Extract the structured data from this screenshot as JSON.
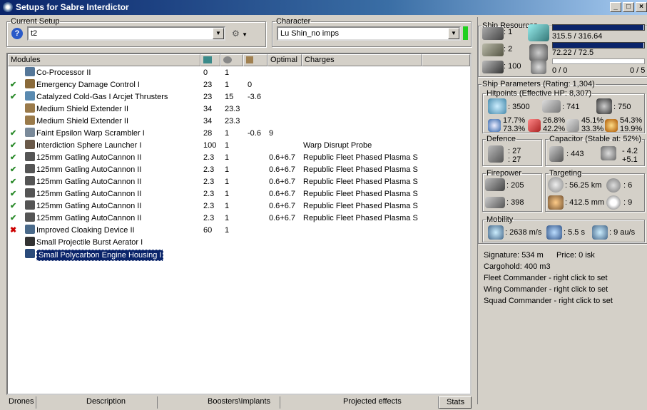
{
  "window": {
    "title": "Setups for Sabre Interdictor",
    "buttons": [
      "_",
      "□",
      "×"
    ]
  },
  "current_setup": {
    "legend": "Current Setup",
    "value": "t2"
  },
  "character": {
    "legend": "Character",
    "value": "Lu Shin_no imps"
  },
  "modules": {
    "headers": [
      "Modules",
      "",
      "",
      "",
      "Optimal",
      "Charges"
    ],
    "rows": [
      {
        "status": "",
        "name": "Co-Processor II",
        "c1": "0",
        "c2": "1",
        "c3": "",
        "optimal": "",
        "charges": "",
        "icon": "cpu-icon",
        "color": "#557799"
      },
      {
        "status": "check",
        "name": "Emergency Damage Control I",
        "c1": "23",
        "c2": "1",
        "c3": "0",
        "optimal": "",
        "charges": "",
        "icon": "damage-control-icon",
        "color": "#8a6a3a"
      },
      {
        "status": "check",
        "name": "Catalyzed Cold-Gas I Arcjet Thrusters",
        "c1": "23",
        "c2": "15",
        "c3": "-3.6",
        "optimal": "",
        "charges": "",
        "icon": "thruster-icon",
        "color": "#5a8ab0"
      },
      {
        "status": "",
        "name": "Medium Shield Extender II",
        "c1": "34",
        "c2": "23.3",
        "c3": "",
        "optimal": "",
        "charges": "",
        "icon": "shield-extender-icon",
        "color": "#9a7a4a"
      },
      {
        "status": "",
        "name": "Medium Shield Extender II",
        "c1": "34",
        "c2": "23.3",
        "c3": "",
        "optimal": "",
        "charges": "",
        "icon": "shield-extender-icon",
        "color": "#9a7a4a"
      },
      {
        "status": "check",
        "name": "Faint Epsilon Warp Scrambler I",
        "c1": "28",
        "c2": "1",
        "c3": "-0.6",
        "optimal": "9",
        "charges": "",
        "icon": "warp-scrambler-icon",
        "color": "#7a8a9a"
      },
      {
        "status": "check",
        "name": "Interdiction Sphere Launcher I",
        "c1": "100",
        "c2": "1",
        "c3": "",
        "optimal": "",
        "charges": "Warp Disrupt Probe",
        "icon": "launcher-icon",
        "color": "#6a5a4a"
      },
      {
        "status": "check",
        "name": "125mm Gatling AutoCannon II",
        "c1": "2.3",
        "c2": "1",
        "c3": "",
        "optimal": "0.6+6.7",
        "charges": "Republic Fleet Phased Plasma S",
        "icon": "autocannon-icon",
        "color": "#555555"
      },
      {
        "status": "check",
        "name": "125mm Gatling AutoCannon II",
        "c1": "2.3",
        "c2": "1",
        "c3": "",
        "optimal": "0.6+6.7",
        "charges": "Republic Fleet Phased Plasma S",
        "icon": "autocannon-icon",
        "color": "#555555"
      },
      {
        "status": "check",
        "name": "125mm Gatling AutoCannon II",
        "c1": "2.3",
        "c2": "1",
        "c3": "",
        "optimal": "0.6+6.7",
        "charges": "Republic Fleet Phased Plasma S",
        "icon": "autocannon-icon",
        "color": "#555555"
      },
      {
        "status": "check",
        "name": "125mm Gatling AutoCannon II",
        "c1": "2.3",
        "c2": "1",
        "c3": "",
        "optimal": "0.6+6.7",
        "charges": "Republic Fleet Phased Plasma S",
        "icon": "autocannon-icon",
        "color": "#555555"
      },
      {
        "status": "check",
        "name": "125mm Gatling AutoCannon II",
        "c1": "2.3",
        "c2": "1",
        "c3": "",
        "optimal": "0.6+6.7",
        "charges": "Republic Fleet Phased Plasma S",
        "icon": "autocannon-icon",
        "color": "#555555"
      },
      {
        "status": "check",
        "name": "125mm Gatling AutoCannon II",
        "c1": "2.3",
        "c2": "1",
        "c3": "",
        "optimal": "0.6+6.7",
        "charges": "Republic Fleet Phased Plasma S",
        "icon": "autocannon-icon",
        "color": "#555555"
      },
      {
        "status": "x",
        "name": "Improved Cloaking Device II",
        "c1": "60",
        "c2": "1",
        "c3": "",
        "optimal": "",
        "charges": "",
        "icon": "cloak-icon",
        "color": "#4a6a8a"
      },
      {
        "status": "",
        "name": "Small Projectile Burst Aerator I",
        "c1": "",
        "c2": "",
        "c3": "",
        "optimal": "",
        "charges": "",
        "icon": "rig-icon",
        "color": "#333333"
      },
      {
        "status": "",
        "name": "Small Polycarbon Engine Housing I",
        "c1": "",
        "c2": "",
        "c3": "",
        "optimal": "",
        "charges": "",
        "icon": "rig-icon",
        "color": "#2a4a7a",
        "selected": true
      }
    ]
  },
  "tabs": [
    "Drones",
    "Description",
    "Boosters\\Implants",
    "Projected effects",
    "Stats"
  ],
  "resources": {
    "legend": "Ship Resources",
    "hardpoints": [
      ": 1",
      ": 2",
      ": 100"
    ],
    "cpu": {
      "text": "315.5 / 316.64",
      "fraction": 0.996
    },
    "power": {
      "text": "72.22 / 72.5",
      "fraction": 0.996
    },
    "calibration": {
      "left": "0 / 0",
      "right": "0 / 5"
    }
  },
  "params": {
    "legend": "Ship Parameters (Rating: 1,304)",
    "hitpoints": {
      "legend": "Hitpoints (Effective HP: 8,307)",
      "shield": ": 3500",
      "armor": ": 741",
      "structure": ": 750",
      "em": [
        "17.7%",
        "73.3%"
      ],
      "thermal": [
        "26.8%",
        "42.2%"
      ],
      "kinetic": [
        "45.1%",
        "33.3%"
      ],
      "explosive": [
        "54.3%",
        "19.9%"
      ]
    },
    "defence": {
      "legend": "Defence",
      "v1": ": 27",
      "v2": ": 27"
    },
    "capacitor": {
      "legend": "Capacitor (Stable at: 52%)",
      "cap": ": 443",
      "d1": "- 4.2",
      "d2": "+5.1"
    },
    "firepower": {
      "legend": "Firepower",
      "dps": ": 205",
      "volley": ": 398"
    },
    "targeting": {
      "legend": "Targeting",
      "range": ": 56.25 km",
      "targets": ": 6",
      "res": ": 412.5 mm",
      "sensor": ": 9"
    },
    "mobility": {
      "legend": "Mobility",
      "speed": ": 2638 m/s",
      "align": ": 5.5 s",
      "warp": ": 9 au/s"
    }
  },
  "info": {
    "signature": "Signature: 534 m",
    "price": "Price: 0 isk",
    "cargo": "Cargohold: 400 m3",
    "fleet": "Fleet Commander - right click to set",
    "wing": "Wing Commander - right click to set",
    "squad": "Squad Commander - right click to set"
  }
}
